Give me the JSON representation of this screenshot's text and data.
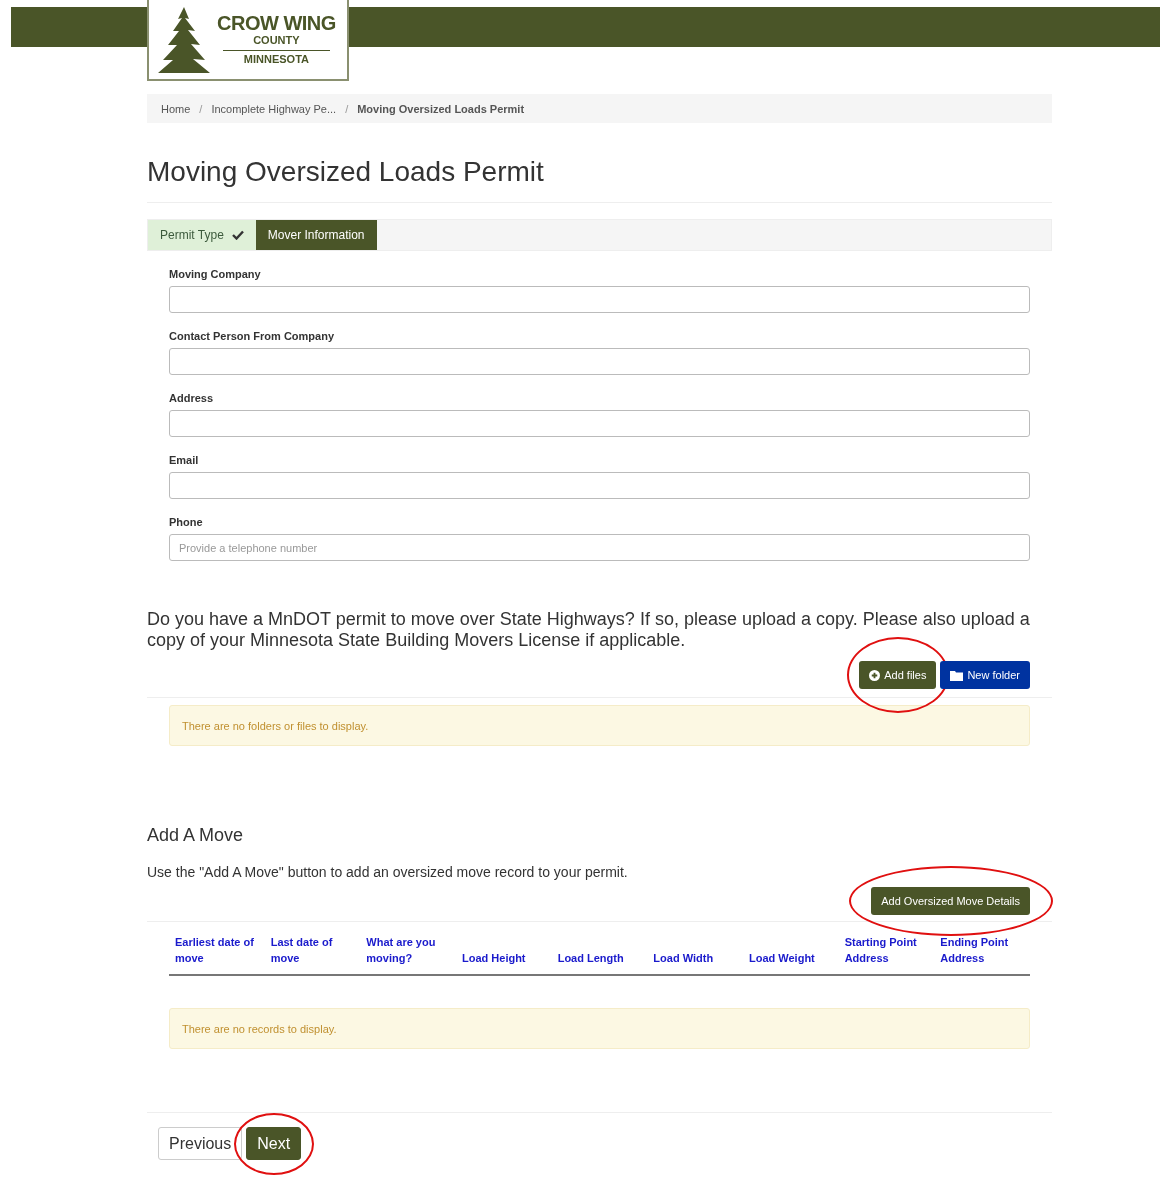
{
  "logo": {
    "line_1": "CROW WING",
    "line_2": "COUNTY",
    "line_3": "MINNESOTA"
  },
  "breadcrumb": [
    {
      "label": "Home",
      "current": false
    },
    {
      "separator": "/",
      "label": "Incomplete Highway Pe...",
      "current": false
    },
    {
      "separator": "/",
      "label": "Moving Oversized Loads Permit",
      "current": true
    }
  ],
  "title": "Moving Oversized Loads Permit",
  "steps": [
    {
      "label": "Permit Type",
      "done": true,
      "selected": false
    },
    {
      "label": "Mover Information",
      "done": false,
      "selected": true
    }
  ],
  "fields": [
    {
      "label": "Moving Company"
    },
    {
      "label": "Contact Person From Company"
    },
    {
      "label": "Address"
    },
    {
      "label": "Email"
    },
    {
      "label": "Phone",
      "placeholder": "Provide a telephone number"
    }
  ],
  "upload": {
    "question": "Do you have a MnDOT permit to move over State Highways? If so, please upload a copy. Please also upload a copy of your Minnesota State Building Movers License if applicable.",
    "add_files": {
      "label": "Add files",
      "circled": true
    },
    "new_folder": {
      "label": "New folder",
      "circled": false
    },
    "empty_message": "There are no folders or files to display."
  },
  "moves": {
    "heading": "Add A Move",
    "hint": "Use the \"Add A Move\" button to add an oversized move record to your permit.",
    "add_button": {
      "label": "Add Oversized Move Details",
      "circled": true
    },
    "columns": [
      "Earliest date of move",
      "Last date of move",
      "What are you moving?",
      "Load Height",
      "Load Length",
      "Load Width",
      "Load Weight",
      "Starting Point Address",
      "Ending Point Address"
    ],
    "empty_message": "There are no records to display."
  },
  "nav": {
    "previous": {
      "label": "Previous",
      "circled": false
    },
    "next": {
      "label": "Next",
      "circled": true
    }
  }
}
